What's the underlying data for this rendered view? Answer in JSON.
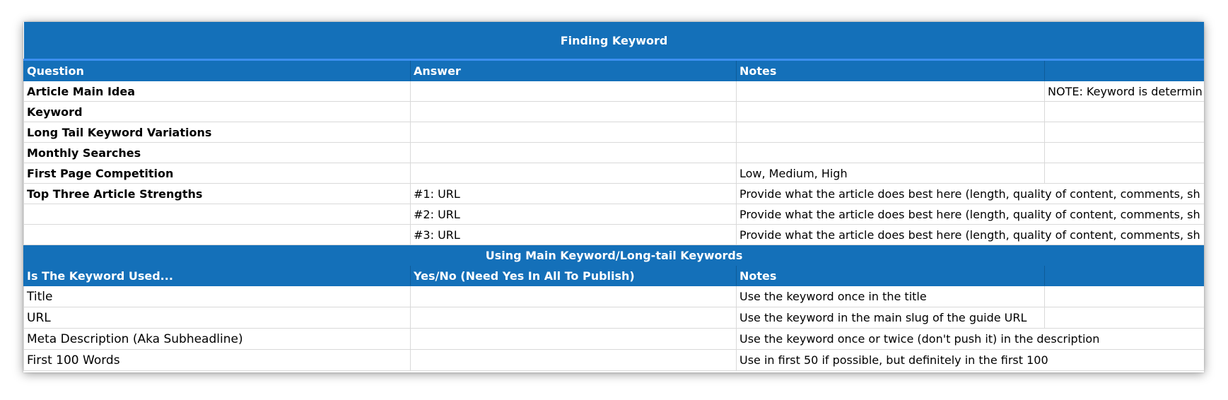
{
  "section1": {
    "title": "Finding Keyword",
    "headers": [
      "Question",
      "Answer",
      "Notes",
      ""
    ],
    "rows": [
      [
        "Article Main Idea",
        "",
        "",
        "NOTE: Keyword is determin"
      ],
      [
        "Keyword",
        "",
        "",
        ""
      ],
      [
        "Long Tail Keyword Variations",
        "",
        "",
        ""
      ],
      [
        "Monthly Searches",
        "",
        "",
        ""
      ],
      [
        "First Page Competition",
        "",
        "Low, Medium, High",
        ""
      ],
      [
        "Top Three Article Strengths",
        "#1: URL",
        "Provide what the article does best here (length, quality of content, comments, sh",
        ""
      ],
      [
        "",
        "#2: URL",
        "Provide what the article does best here (length, quality of content, comments, sh",
        ""
      ],
      [
        "",
        "#3: URL",
        "Provide what the article does best here (length, quality of content, comments, sh",
        ""
      ]
    ]
  },
  "section2": {
    "title": "Using Main Keyword/Long-tail Keywords",
    "headers": [
      "Is The Keyword Used...",
      "Yes/No (Need Yes In All To Publish)",
      "Notes",
      ""
    ],
    "rows": [
      [
        "Title",
        "",
        "Use the keyword once in the title",
        ""
      ],
      [
        "URL",
        "",
        "Use the keyword in the main slug of the guide URL",
        ""
      ],
      [
        "Meta Description (Aka Subheadline)",
        "",
        "Use the keyword once or twice (don't push it) in the description"
      ],
      [
        "First 100 Words",
        "",
        "Use in first 50 if possible, but definitely in the first 100"
      ]
    ]
  },
  "colors": {
    "header_bg": "#1470b9",
    "header_text": "#ffffff",
    "accent_line": "#3d8ff0",
    "grid": "#d9d9d9"
  }
}
